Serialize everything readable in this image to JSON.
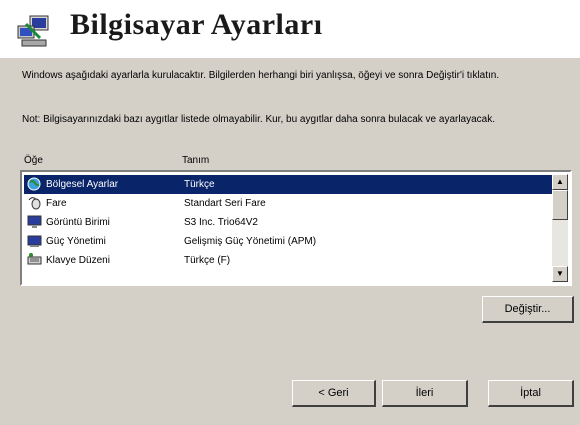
{
  "dialog": {
    "title": "Bilgisayar Ayarları",
    "intro": "Windows aşağıdaki ayarlarla kurulacaktır. Bilgilerden herhangi biri yanlışsa, öğeyi ve sonra Değiştir'i tıklatın.",
    "note": "Not: Bilgisayarınızdaki bazı aygıtlar listede olmayabilir. Kur, bu aygıtlar daha sonra bulacak ve ayarlayacak."
  },
  "list": {
    "columns": [
      "Öğe",
      "Tanım"
    ],
    "rows": [
      {
        "name": "Bölgesel Ayarlar",
        "desc": "Türkçe",
        "icon": "globe-icon",
        "selected": true
      },
      {
        "name": "Fare",
        "desc": "Standart Seri Fare",
        "icon": "mouse-icon",
        "selected": false
      },
      {
        "name": "Görüntü Birimi",
        "desc": "S3 Inc. Trio64V2",
        "icon": "monitor-icon",
        "selected": false
      },
      {
        "name": "Güç Yönetimi",
        "desc": "Gelişmiş Güç Yönetimi (APM)",
        "icon": "power-icon",
        "selected": false
      },
      {
        "name": "Klavye Düzeni",
        "desc": "Türkçe (F)",
        "icon": "keyboard-icon",
        "selected": false
      }
    ]
  },
  "buttons": {
    "change": "Değiştir...",
    "back": "< Geri",
    "next": "İleri",
    "cancel": "İptal"
  },
  "colors": {
    "selection": "#0a246a",
    "face": "#d4d0c8"
  }
}
